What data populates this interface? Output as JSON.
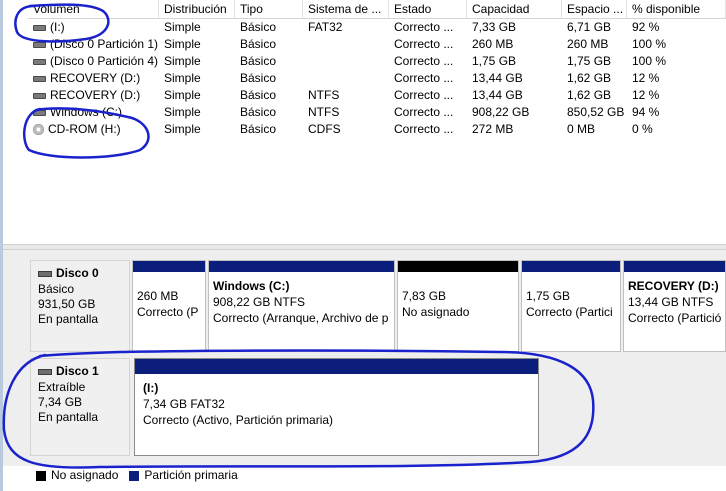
{
  "columns": [
    "Volumen",
    "Distribución",
    "Tipo",
    "Sistema de ...",
    "Estado",
    "Capacidad",
    "Espacio ...",
    "% disponible"
  ],
  "volumes": [
    {
      "icon": "disk-icon",
      "name": "(I:)",
      "layout": "Simple",
      "type": "Básico",
      "fs": "FAT32",
      "status": "Correcto ...",
      "capacity": "7,33 GB",
      "free": "6,71 GB",
      "pct": "92 %"
    },
    {
      "icon": "disk-icon",
      "name": "(Disco 0 Partición 1)",
      "layout": "Simple",
      "type": "Básico",
      "fs": "",
      "status": "Correcto ...",
      "capacity": "260 MB",
      "free": "260 MB",
      "pct": "100 %"
    },
    {
      "icon": "disk-icon",
      "name": "(Disco 0 Partición 4)",
      "layout": "Simple",
      "type": "Básico",
      "fs": "",
      "status": "Correcto ...",
      "capacity": "1,75 GB",
      "free": "1,75 GB",
      "pct": "100 %"
    },
    {
      "icon": "disk-icon",
      "name": "RECOVERY (D:)",
      "layout": "Simple",
      "type": "Básico",
      "fs": "",
      "status": "Correcto ...",
      "capacity": "13,44 GB",
      "free": "1,62 GB",
      "pct": "12 %"
    },
    {
      "icon": "disk-icon",
      "name": "RECOVERY (D:)",
      "layout": "Simple",
      "type": "Básico",
      "fs": "NTFS",
      "status": "Correcto ...",
      "capacity": "13,44 GB",
      "free": "1,62 GB",
      "pct": "12 %"
    },
    {
      "icon": "disk-icon",
      "name": "Windows (C:)",
      "layout": "Simple",
      "type": "Básico",
      "fs": "NTFS",
      "status": "Correcto ...",
      "capacity": "908,22 GB",
      "free": "850,52 GB",
      "pct": "94 %"
    },
    {
      "icon": "cd-icon",
      "name": "CD-ROM (H:)",
      "layout": "Simple",
      "type": "Básico",
      "fs": "CDFS",
      "status": "Correcto ...",
      "capacity": "272 MB",
      "free": "0 MB",
      "pct": "0 %"
    }
  ],
  "disks": [
    {
      "name": "Disco 0",
      "kind": "Básico",
      "size": "931,50 GB",
      "state": "En pantalla",
      "partitions": [
        {
          "title": "",
          "line1": "260 MB",
          "line2": "Correcto (P",
          "band": "primary"
        },
        {
          "title": "Windows  (C:)",
          "line1": "908,22 GB NTFS",
          "line2": "Correcto (Arranque, Archivo de p",
          "band": "primary"
        },
        {
          "title": "",
          "line1": "7,83 GB",
          "line2": "No asignado",
          "band": "unallocated"
        },
        {
          "title": "",
          "line1": "1,75 GB",
          "line2": "Correcto (Partici",
          "band": "primary"
        },
        {
          "title": "RECOVERY  (D:)",
          "line1": "13,44 GB NTFS",
          "line2": "Correcto (Partició",
          "band": "primary"
        }
      ]
    },
    {
      "name": "Disco 1",
      "kind": "Extraíble",
      "size": "7,34 GB",
      "state": "En pantalla",
      "partitions": [
        {
          "title": "(I:)",
          "line1": "7,34 GB FAT32",
          "line2": "Correcto (Activo, Partición primaria)",
          "band": "primary"
        }
      ]
    }
  ],
  "legend": [
    {
      "label": "No asignado",
      "color": "#000000"
    },
    {
      "label": "Partición primaria",
      "color": "#0b1e7c"
    }
  ],
  "colors": {
    "primary": "#0b1e7c",
    "unallocated": "#000000",
    "annotation": "#1a22cc"
  }
}
